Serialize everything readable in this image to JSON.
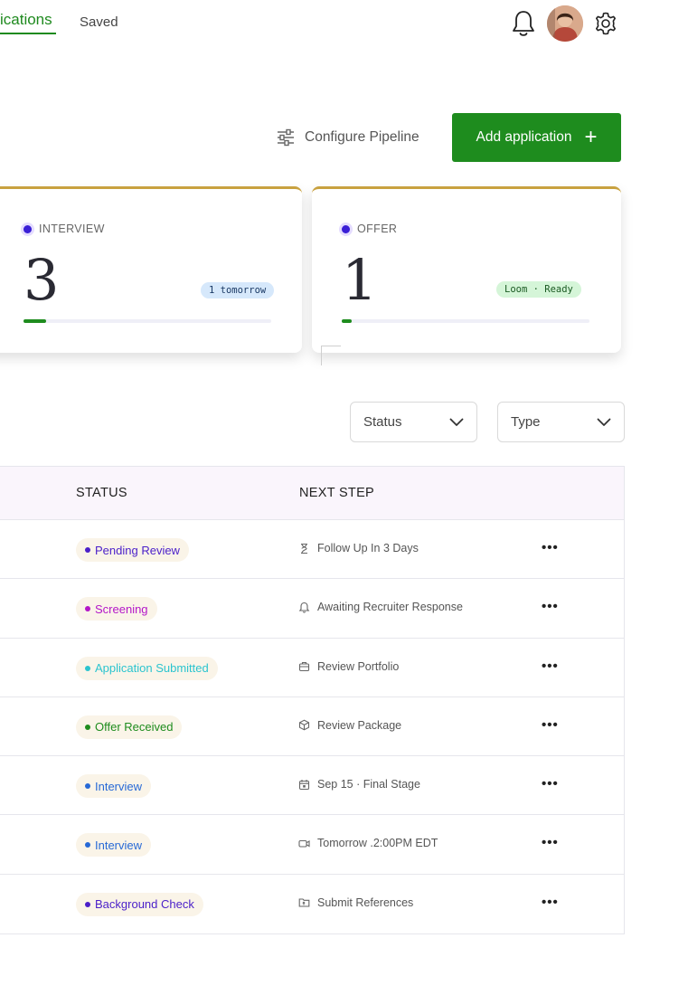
{
  "nav": {
    "active_tab": "ications",
    "saved_tab": "Saved"
  },
  "actions": {
    "configure_label": "Configure Pipeline",
    "add_label": "Add application",
    "add_icon": "+"
  },
  "cards": [
    {
      "label": "INTERVIEW",
      "count": "3",
      "pill": "1 tomorrow",
      "progress": 0.09
    },
    {
      "label": "OFFER",
      "count": "1",
      "pill": "Loom · Ready",
      "progress": 0.04
    }
  ],
  "filters": {
    "status_label": "Status",
    "type_label": "Type"
  },
  "table": {
    "headers": {
      "status": "STATUS",
      "next_step": "NEXT STEP"
    },
    "rows": [
      {
        "status": "Pending Review",
        "status_color": "#4a1fc9",
        "next_step": "Follow Up In 3 Days",
        "step_icon": "hourglass-icon"
      },
      {
        "status": "Screening",
        "status_color": "#b317c9",
        "next_step": "Awaiting Recruiter Response",
        "step_icon": "bell-icon"
      },
      {
        "status": "Application Submitted",
        "status_color": "#2bc4cf",
        "next_step": "Review Portfolio",
        "step_icon": "briefcase-icon"
      },
      {
        "status": "Offer Received",
        "status_color": "#1e8c1e",
        "next_step": "Review Package",
        "step_icon": "package-icon"
      },
      {
        "status": "Interview",
        "status_color": "#2769d6",
        "next_step": "Sep 15 · Final Stage",
        "step_icon": "calendar-icon"
      },
      {
        "status": "Interview",
        "status_color": "#2769d6",
        "next_step": "Tomorrow .2:00PM EDT",
        "step_icon": "video-icon"
      },
      {
        "status": "Background Check",
        "status_color": "#4a1fc9",
        "next_step": "Submit References",
        "step_icon": "folder-icon"
      }
    ],
    "more_label": "•••"
  }
}
